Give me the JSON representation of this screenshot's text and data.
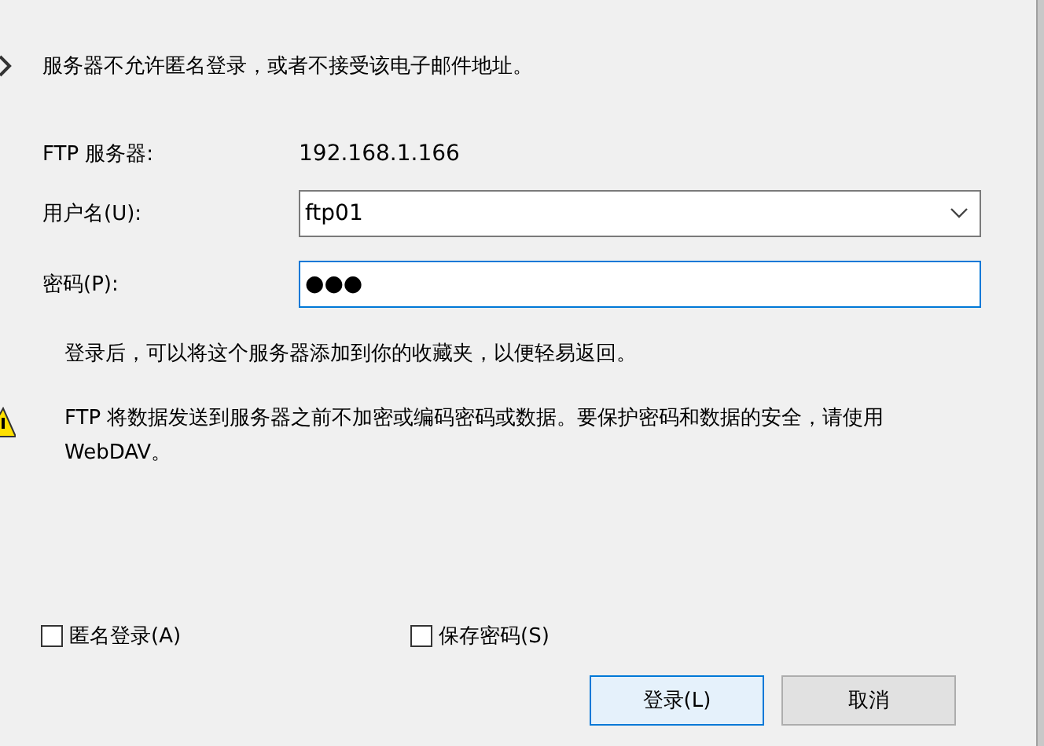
{
  "message": "服务器不允许匿名登录，或者不接受该电子邮件地址。",
  "server": {
    "label": "FTP 服务器:",
    "value": "192.168.1.166"
  },
  "username": {
    "label": "用户名(U):",
    "value": "ftp01"
  },
  "password": {
    "label": "密码(P):",
    "value": "●●●"
  },
  "info": "登录后，可以将这个服务器添加到你的收藏夹，以便轻易返回。",
  "warning": "FTP 将数据发送到服务器之前不加密或编码密码或数据。要保护密码和数据的安全，请使用 WebDAV。",
  "checkboxes": [
    {
      "label": "匿名登录(A)",
      "checked": false
    },
    {
      "label": "保存密码(S)",
      "checked": false
    }
  ],
  "buttons": [
    {
      "label": "登录(L)",
      "kind": "default"
    },
    {
      "label": "取消",
      "kind": "normal"
    }
  ]
}
